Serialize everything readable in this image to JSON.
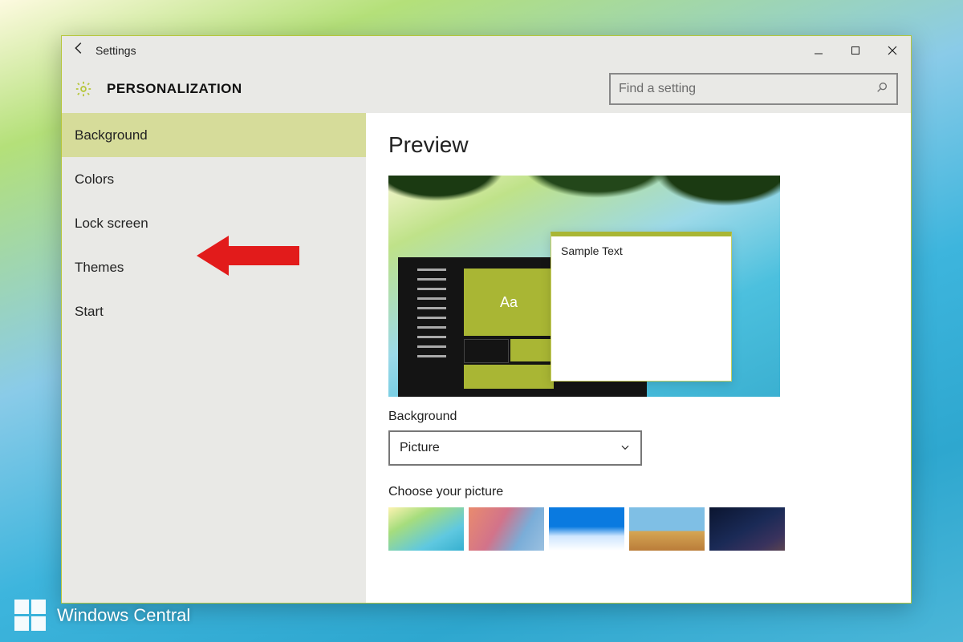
{
  "window": {
    "app_title": "Settings",
    "page_header": "PERSONALIZATION",
    "search_placeholder": "Find a setting"
  },
  "sidebar": {
    "items": [
      {
        "label": "Background",
        "active": true
      },
      {
        "label": "Colors"
      },
      {
        "label": "Lock screen"
      },
      {
        "label": "Themes"
      },
      {
        "label": "Start"
      }
    ]
  },
  "content": {
    "preview_heading": "Preview",
    "preview_window_text": "Sample Text",
    "start_tile_text": "Aa",
    "background_label": "Background",
    "background_value": "Picture",
    "choose_label": "Choose your picture"
  },
  "accent_color": "#a9b634",
  "watermark": "Windows Central",
  "annotation": {
    "type": "arrow",
    "points_to": "Lock screen",
    "color": "#e21b1b"
  }
}
